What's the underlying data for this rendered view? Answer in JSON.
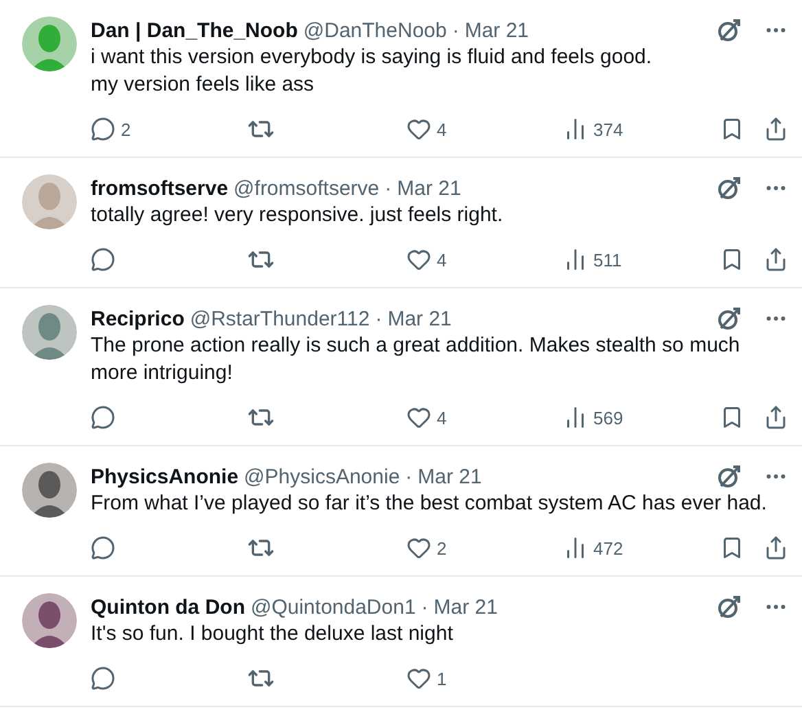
{
  "replies": [
    {
      "name": "Dan | Dan_The_Noob",
      "handle": "@DanTheNoob",
      "separator": "·",
      "date": "Mar 21",
      "text": [
        "i want this version everybody is saying is fluid and feels good.",
        "my version feels like ass"
      ],
      "replies": "2",
      "likes": "4",
      "views": "374"
    },
    {
      "name": "fromsoftserve",
      "handle": "@fromsoftserve",
      "separator": "·",
      "date": "Mar 21",
      "text": [
        "totally agree! very responsive. just feels right."
      ],
      "likes": "4",
      "views": "511"
    },
    {
      "name": "Reciprico",
      "handle": "@RstarThunder112",
      "separator": "·",
      "date": "Mar 21",
      "text": [
        "The prone action really is such a great addition. Makes stealth so much more intriguing!"
      ],
      "likes": "4",
      "views": "569"
    },
    {
      "name": "PhysicsAnonie",
      "handle": "@PhysicsAnonie",
      "separator": "·",
      "date": "Mar 21",
      "text": [
        "From what I’ve played so far it’s the best combat system AC has ever had."
      ],
      "likes": "2",
      "views": "472"
    },
    {
      "name": "Quinton da Don",
      "handle": "@QuintondaDon1",
      "separator": "·",
      "date": "Mar 21",
      "text": [
        "It's so fun. I bought the deluxe last night"
      ],
      "likes": "1"
    }
  ]
}
